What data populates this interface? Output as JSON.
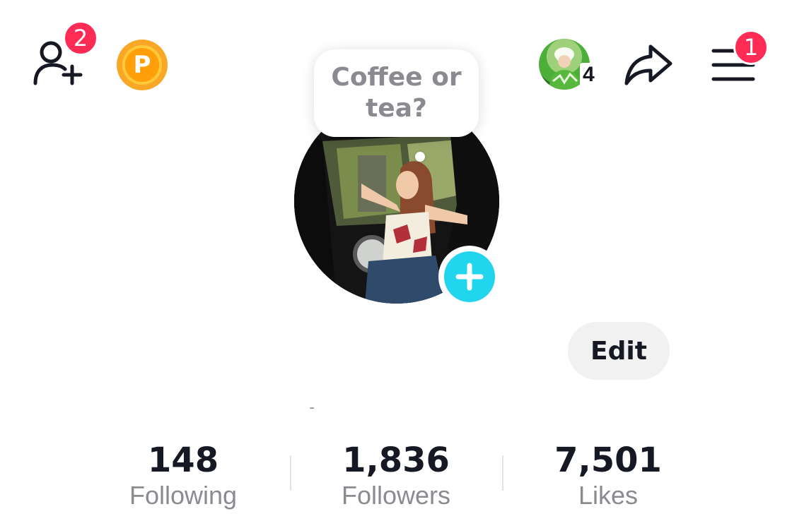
{
  "header": {
    "add_friends_badge": "2",
    "coin_letter": "P",
    "visitor_count": "4",
    "menu_badge": "1"
  },
  "profile": {
    "note_text": "Coffee or tea?",
    "edit_label": "Edit",
    "bio_text": "-"
  },
  "stats": {
    "following": {
      "value": "148",
      "label": "Following"
    },
    "followers": {
      "value": "1,836",
      "label": "Followers"
    },
    "likes": {
      "value": "7,501",
      "label": "Likes"
    }
  },
  "colors": {
    "badge_red": "#fe2c55",
    "add_cyan": "#20d5ec",
    "coin_orange": "#ff9f0a",
    "edit_bg": "#f1f1f2",
    "muted_text": "#8a8b91"
  },
  "icons": {
    "add_friends": "person-plus-icon",
    "coin": "coin-icon",
    "share": "share-arrow-icon",
    "menu": "hamburger-menu-icon",
    "add_avatar": "plus-icon"
  }
}
